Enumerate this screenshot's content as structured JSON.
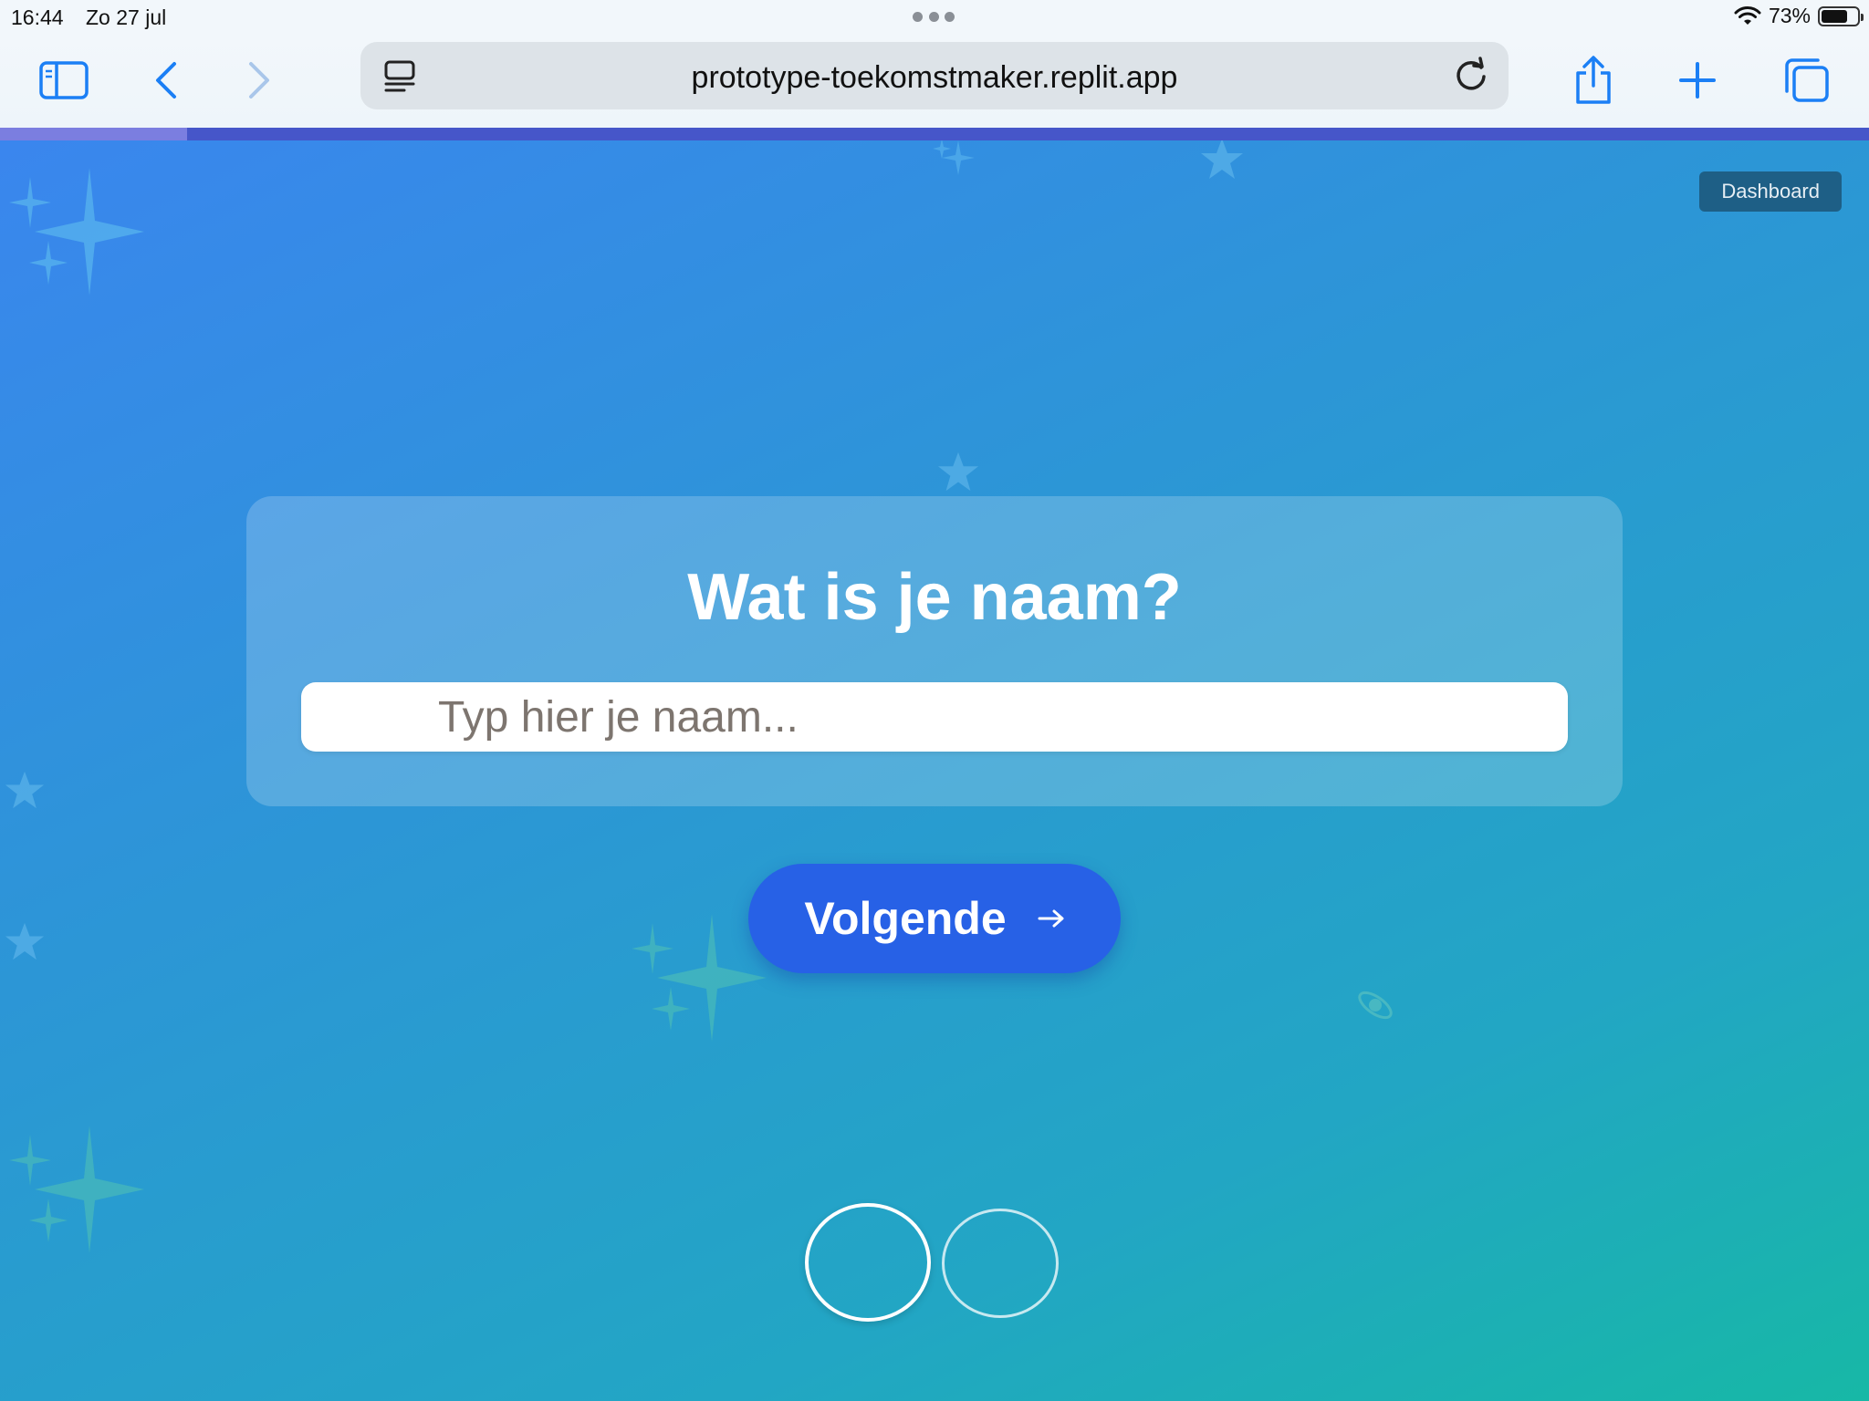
{
  "status_bar": {
    "time": "16:44",
    "date": "Zo 27 jul",
    "battery": "73%",
    "battery_level": 0.73
  },
  "browser": {
    "url": "prototype-toekomstmaker.replit.app",
    "icons": [
      "sidebar-icon",
      "back-icon",
      "forward-icon",
      "page-menu-icon",
      "reload-icon",
      "share-icon",
      "new-tab-icon",
      "tabs-icon"
    ],
    "load_progress": 0.1
  },
  "page": {
    "dashboard_label": "Dashboard",
    "title": "Wat is je naam?",
    "name_input": {
      "placeholder": "Typ hier je naam...",
      "value": ""
    },
    "next_button": {
      "label": "Volgende",
      "icon": "arrow-right-icon"
    },
    "colors": {
      "gradient_start": "#3a86ee",
      "gradient_end": "#17b8a6",
      "button": "#2761e6",
      "dashboard_bg": "#1e5f86"
    }
  }
}
